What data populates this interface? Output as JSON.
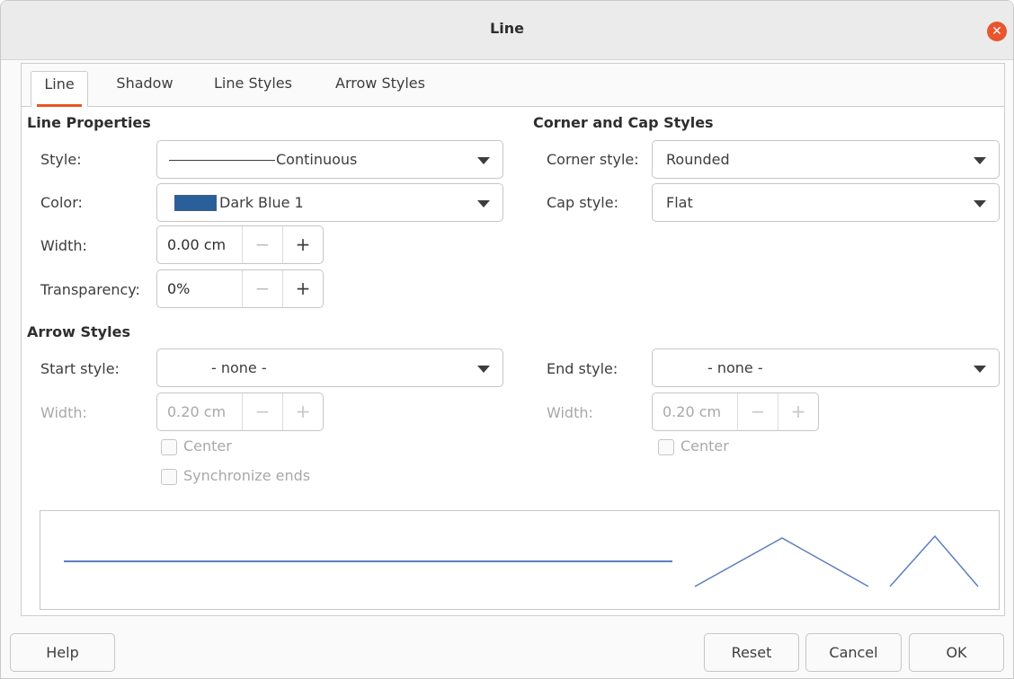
{
  "window": {
    "title": "Line"
  },
  "tabs": [
    "Line",
    "Shadow",
    "Line Styles",
    "Arrow Styles"
  ],
  "line_properties": {
    "title": "Line Properties",
    "style_label": "Style:",
    "style_value": "Continuous",
    "color_label": "Color:",
    "color_value": "Dark Blue 1",
    "color_swatch": "#2a6099",
    "width_label": "Width:",
    "width_value": "0.00 cm",
    "transparency_label": "Transparency:",
    "transparency_value": "0%"
  },
  "corner_cap": {
    "title": "Corner and Cap Styles",
    "corner_label": "Corner style:",
    "corner_value": "Rounded",
    "cap_label": "Cap style:",
    "cap_value": "Flat"
  },
  "arrow_styles": {
    "title": "Arrow Styles",
    "start_label": "Start style:",
    "start_value": "- none -",
    "start_width_label": "Width:",
    "start_width_value": "0.20 cm",
    "start_center_label": "Center",
    "sync_label": "Synchronize ends",
    "end_label": "End style:",
    "end_value": "- none -",
    "end_width_label": "Width:",
    "end_width_value": "0.20 cm",
    "end_center_label": "Center"
  },
  "buttons": {
    "help": "Help",
    "reset": "Reset",
    "cancel": "Cancel",
    "ok": "OK"
  },
  "colors": {
    "accent": "#e95420",
    "line_preview": "#5b7fc0"
  }
}
